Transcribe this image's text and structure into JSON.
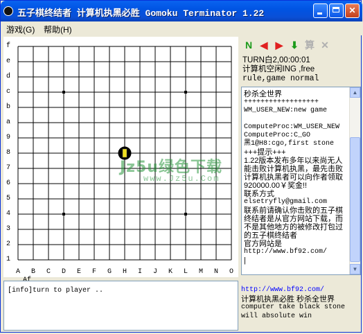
{
  "window": {
    "title": "五子棋终结者 计算机执黑必胜 Gomoku Terminator 1.22",
    "controls": [
      "minimize",
      "maximize",
      "close"
    ]
  },
  "menu": {
    "items": [
      "游戏(G)",
      "帮助(H)"
    ]
  },
  "board": {
    "row_labels": [
      "f",
      "e",
      "d",
      "c",
      "b",
      "a",
      "9",
      "8",
      "7",
      "6",
      "5",
      "4",
      "3",
      "2",
      "1"
    ],
    "col_labels": [
      "A",
      "B",
      "C",
      "D",
      "E",
      "F",
      "G",
      "H",
      "I",
      "J",
      "K",
      "L",
      "M",
      "N",
      "O"
    ],
    "coord_readout": "Af",
    "star_points": [
      "D12",
      "L12",
      "D4",
      "L4"
    ],
    "stones": [
      {
        "pos": "H8",
        "color": "black",
        "last_move": true
      }
    ]
  },
  "toolbar": {
    "buttons": [
      {
        "icon": "new-game-icon",
        "color": "#1a9a1a"
      },
      {
        "icon": "arrow-left-icon",
        "color": "#e02020"
      },
      {
        "icon": "arrow-right-icon",
        "color": "#e02020"
      },
      {
        "icon": "arrow-down-icon",
        "color": "#1a9a1a"
      },
      {
        "icon": "compute-icon",
        "label": "算",
        "color": "#b0b0b0"
      },
      {
        "icon": "cancel-icon",
        "label": "✕",
        "color": "#b0b0b0"
      }
    ]
  },
  "status": {
    "turn": "TURN白2,00:00:01",
    "state": "计算机空闲ING ,free",
    "rule": "rule,game normal"
  },
  "messages": [
    "秒杀全世界",
    "",
    "++++++++++++++++++",
    "WM_USER_NEW:new game",
    "",
    "ComputeProc:WM_USER_NEW",
    "ComputeProc:C_GO",
    "黑1@H8:cgo,first stone",
    "+++提示+++",
    "1.22版本发布多年以来尚无人能击败计算机执黑，最先击败计算机执黑者可以向作者领取920000.00￥奖金!!",
    "联系方式",
    "elsetryfly@gmail.com",
    "联系前请确认你击败的五子棋终结者是从官方网站下载，而不是其他地方的被修改打包过的五子棋终结者",
    "官方网站是",
    "http://www.bf92.com/",
    "|"
  ],
  "log": {
    "text": "[info]turn to player .."
  },
  "info": {
    "url": "http://www.bf92.com/",
    "line1": "计算机执黑必胜 秒杀全世界",
    "line2": "computer take black stone",
    "line3": "will absolute win"
  },
  "watermark": {
    "main": "Jz5u绿色下载",
    "url": "www.Jz5u.Com"
  }
}
